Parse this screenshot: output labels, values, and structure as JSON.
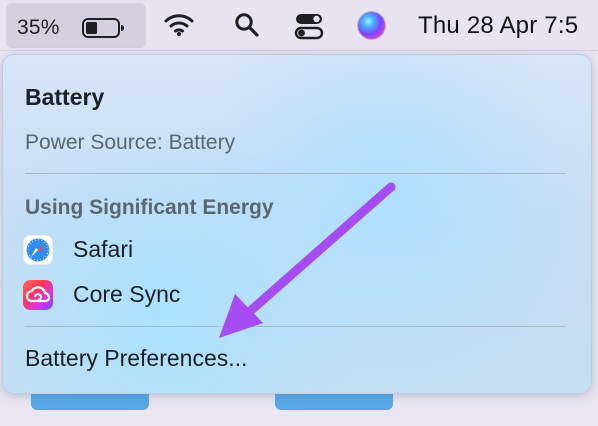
{
  "menu_bar": {
    "battery_percent": "35%",
    "battery_level": 0.35,
    "clock": "Thu 28 Apr 7:5",
    "icons": {
      "battery": "battery-icon",
      "wifi": "wifi-icon",
      "search": "search-icon",
      "control_center": "control-center-icon",
      "siri": "siri-icon"
    }
  },
  "battery_menu": {
    "title": "Battery",
    "power_source": "Power Source: Battery",
    "section_header": "Using Significant Energy",
    "apps": [
      {
        "label": "Safari",
        "icon": "safari-icon"
      },
      {
        "label": "Core Sync",
        "icon": "creative-cloud-icon"
      }
    ],
    "preferences": "Battery Preferences..."
  },
  "annotation": {
    "arrow_color": "#a64df2"
  }
}
